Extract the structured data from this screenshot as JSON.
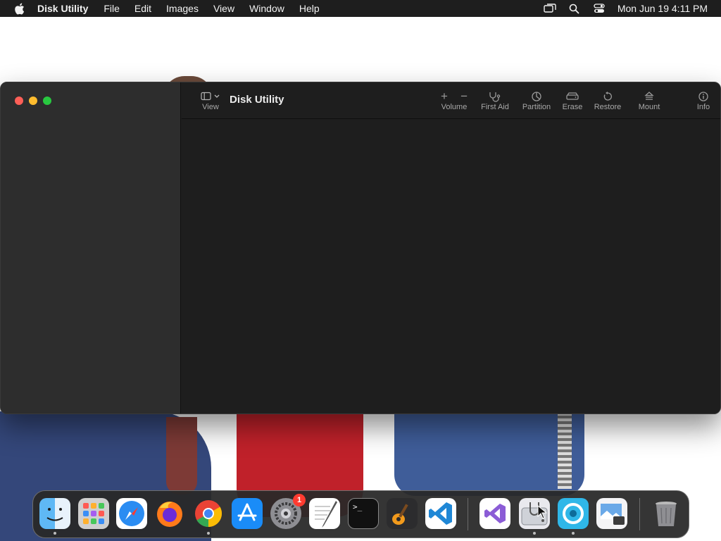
{
  "menubar": {
    "app_name": "Disk Utility",
    "items": [
      "File",
      "Edit",
      "Images",
      "View",
      "Window",
      "Help"
    ],
    "clock": "Mon Jun 19  4:11 PM"
  },
  "window": {
    "title": "Disk Utility",
    "toolbar": {
      "view": "View",
      "volume": "Volume",
      "volume_add": "+",
      "volume_remove": "−",
      "first_aid": "First Aid",
      "partition": "Partition",
      "erase": "Erase",
      "restore": "Restore",
      "mount": "Mount",
      "info": "Info"
    }
  },
  "dock": {
    "apps": [
      "finder",
      "launchpad",
      "safari",
      "firefox",
      "chrome",
      "app-store",
      "system-settings",
      "textedit",
      "terminal",
      "garageband",
      "vscode",
      "visual-studio",
      "disk-utility",
      "proxyman",
      "preview",
      "trash"
    ],
    "system_settings_badge": "1",
    "terminal_prompt": ">_"
  },
  "colors": {
    "close": "#fe5f57",
    "minimize": "#febc2e",
    "maximize": "#28c840",
    "sidebar": "#2d2d2d",
    "content": "#1e1e1e",
    "menubar": "#1e1e1e"
  }
}
